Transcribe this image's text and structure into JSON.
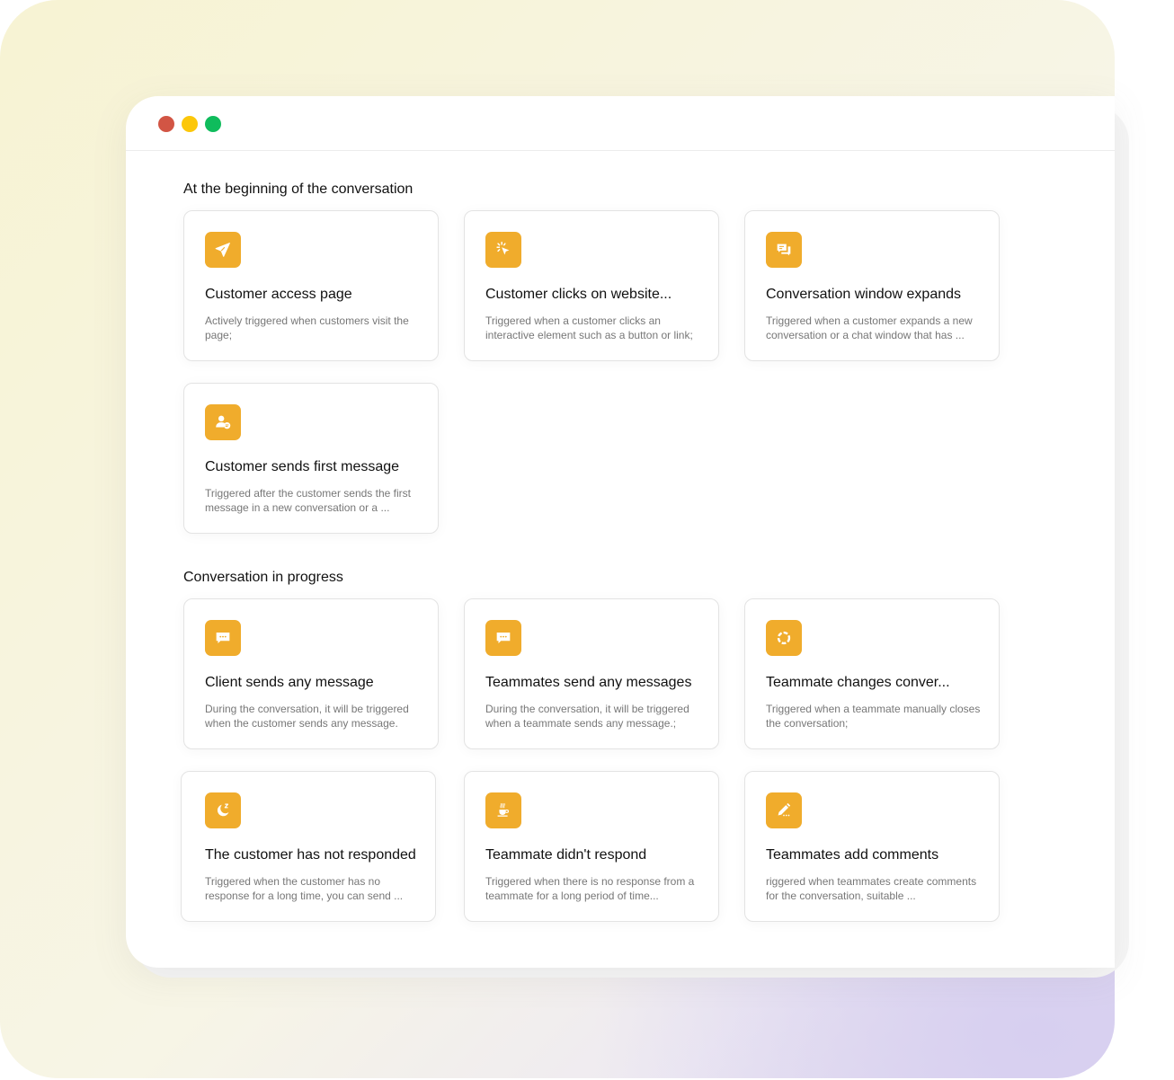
{
  "window": {
    "controls": [
      {
        "name": "close",
        "color": "#d25544"
      },
      {
        "name": "minimize",
        "color": "#fcc70a"
      },
      {
        "name": "maximize",
        "color": "#0fbc5c"
      }
    ]
  },
  "accent_color": "#f0ac2c",
  "sections": [
    {
      "title": "At the beginning of the conversation",
      "cards": [
        {
          "icon": "paper-plane-icon",
          "title": "Customer access page",
          "description": "Actively triggered when customers visit the page;"
        },
        {
          "icon": "cursor-click-icon",
          "title": "Customer clicks on website...",
          "description": "Triggered when a customer clicks an interactive element such as a button or link;"
        },
        {
          "icon": "chat-bubbles-icon",
          "title": "Conversation window expands",
          "description": "Triggered when a customer expands a new conversation or a chat window that has  ..."
        },
        {
          "icon": "user-message-icon",
          "title": "Customer sends first message",
          "description": "Triggered after the customer sends the first message in a new conversation or a ..."
        }
      ]
    },
    {
      "title": "Conversation in progress",
      "cards": [
        {
          "icon": "message-dots-icon",
          "title": "Client sends any message",
          "description": "During the conversation, it will be triggered when the customer sends any message."
        },
        {
          "icon": "message-dots-icon",
          "title": "Teammates send any messages",
          "description": "During the conversation, it will be triggered when a teammate sends any message.;"
        },
        {
          "icon": "dashed-circle-icon",
          "title": "Teammate changes conver...",
          "description": "Triggered when a teammate manually closes the conversation;"
        },
        {
          "icon": "moon-sleep-icon",
          "title": "The customer has not responded",
          "description": "Triggered when the customer has no response for a long time, you can send ..."
        },
        {
          "icon": "coffee-cup-icon",
          "title": "Teammate didn't respond",
          "description": "Triggered when there is no response from a teammate for a long period of time..."
        },
        {
          "icon": "pencil-comment-icon",
          "title": "Teammates add comments",
          "description": "riggered when teammates create comments for the conversation, suitable ..."
        }
      ]
    }
  ]
}
